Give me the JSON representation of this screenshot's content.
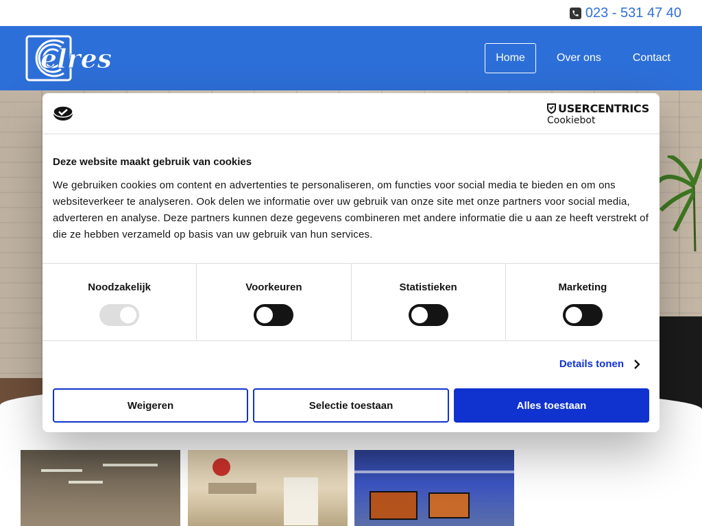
{
  "topbar": {
    "phone": "023 - 531 47 40",
    "phone_icon": "phone-icon"
  },
  "header": {
    "logo_text": "elres",
    "nav": [
      {
        "label": "Home",
        "active": true
      },
      {
        "label": "Over ons",
        "active": false
      },
      {
        "label": "Contact",
        "active": false
      }
    ],
    "color": "#2d6fd8"
  },
  "cookie_dialog": {
    "brand_name": "USERCENTRICS",
    "brand_sub": "Cookiebot",
    "title": "Deze website maakt gebruik van cookies",
    "text": "We gebruiken cookies om content en advertenties te personaliseren, om functies voor social media te bieden en om ons websiteverkeer te analyseren. Ook delen we informatie over uw gebruik van onze site met onze partners voor social media, adverteren en analyse. Deze partners kunnen deze gegevens combineren met andere informatie die u aan ze heeft verstrekt of die ze hebben verzameld op basis van uw gebruik van hun services.",
    "categories": [
      {
        "label": "Noodzakelijk",
        "enabled": true,
        "disabled": true
      },
      {
        "label": "Voorkeuren",
        "enabled": false,
        "disabled": false
      },
      {
        "label": "Statistieken",
        "enabled": false,
        "disabled": false
      },
      {
        "label": "Marketing",
        "enabled": false,
        "disabled": false
      }
    ],
    "details_label": "Details tonen",
    "buttons": {
      "reject": "Weigeren",
      "selection": "Selectie toestaan",
      "accept_all": "Alles toestaan"
    },
    "accent_color": "#1032cf"
  }
}
